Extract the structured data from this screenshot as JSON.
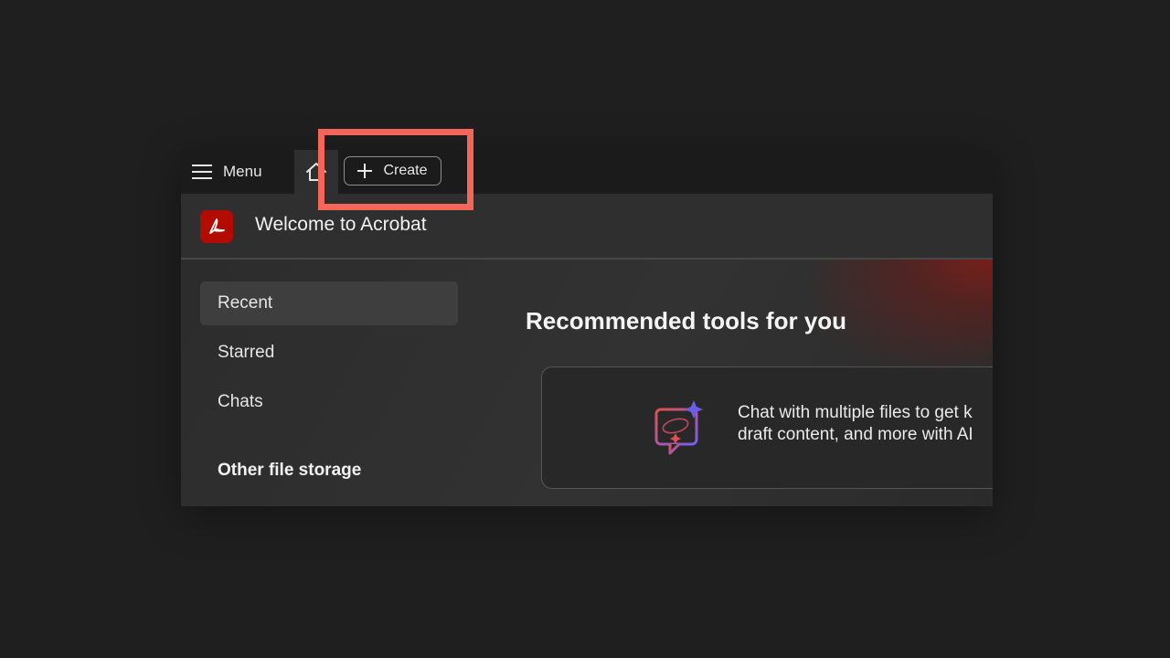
{
  "tabbar": {
    "menu_label": "Menu",
    "home_icon": "home-icon",
    "create_label": "Create"
  },
  "header": {
    "title": "Welcome to Acrobat",
    "logo": "acrobat-logo"
  },
  "sidebar": {
    "items": [
      {
        "label": "Recent",
        "active": true
      },
      {
        "label": "Starred",
        "active": false
      },
      {
        "label": "Chats",
        "active": false
      }
    ],
    "section_title": "Other file storage"
  },
  "main": {
    "title": "Recommended tools for you",
    "card": {
      "line1": "Chat with multiple files to get k",
      "line2": "draft content, and more with AI",
      "icon": "ai-chat-icon"
    }
  },
  "colors": {
    "highlight": "#f4665a",
    "acrobat_red": "#b30b00"
  }
}
